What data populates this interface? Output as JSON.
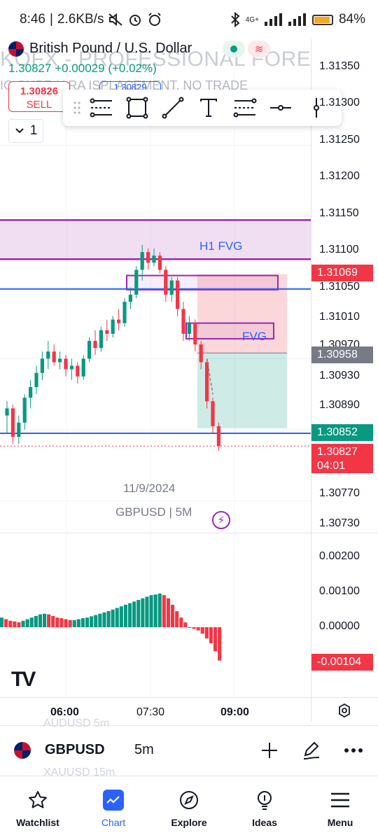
{
  "status_bar": {
    "time": "8:46",
    "network_speed": "2.6KB/s",
    "network_type": "4G+",
    "battery": "84",
    "battery_unit": "%",
    "icons": [
      "mute-icon",
      "alarm-icon",
      "alarm-clock-icon",
      "bluetooth-icon",
      "signal-icon",
      "battery-icon"
    ]
  },
  "header": {
    "title": "British Pound / U.S. Dollar",
    "watermark": "KOFX - PROFESSIONAL FOREX TRAD",
    "watermark_line2": "IG  CURR Y  RA  ISPLACEMENT. NO TRADE",
    "last_price": "1.30827",
    "change": "+0.00029",
    "change_pct": "(+0.02%)",
    "sell_price": "1.30826",
    "sell_label": "SELL",
    "buy_peek": "1.30829",
    "dropdown_value": "1"
  },
  "toolbar": {
    "tools": [
      "drag-handle-icon",
      "long-position-icon",
      "rectangle-icon",
      "trend-line-icon",
      "text-icon",
      "fib-retracement-icon",
      "horizontal-ray-icon",
      "vertical-line-icon"
    ]
  },
  "price_axis": {
    "labels": [
      "1.31350",
      "1.31300",
      "1.31250",
      "1.31200",
      "1.31150",
      "1.31100",
      "1.31050",
      "1.31010",
      "1.30970",
      "1.30930",
      "1.30890",
      "1.30770",
      "1.30730"
    ],
    "osc_labels": [
      "0.00200",
      "0.00100",
      "0.00000"
    ]
  },
  "price_tags": {
    "current_fvg_top": "1.31069",
    "stop_level": "1.30958",
    "target_level": "1.30852",
    "current_price": "1.30827",
    "countdown": "04:01",
    "oscillator_value": "-0.00104"
  },
  "zones": {
    "h1_fvg_label": "H1 FVG",
    "fvg_label": "FVG"
  },
  "chart_meta": {
    "date": "11/9/2024",
    "symbol_interval": "GBPUSD | 5M"
  },
  "time_axis": {
    "labels": [
      "06:00",
      "07:30",
      "09:00"
    ]
  },
  "symbol_bar": {
    "ghost_top": "AUDUSD  5m",
    "ghost_bottom": "XAUUSD  15m",
    "symbol": "GBPUSD",
    "interval": "5m"
  },
  "bottom_nav": [
    {
      "label": "Watchlist",
      "icon": "star-icon"
    },
    {
      "label": "Chart",
      "icon": "chart-icon"
    },
    {
      "label": "Explore",
      "icon": "compass-icon"
    },
    {
      "label": "Ideas",
      "icon": "lightbulb-icon"
    },
    {
      "label": "Menu",
      "icon": "hamburger-icon"
    }
  ],
  "colors": {
    "up": "#089981",
    "down": "#f23645",
    "accent": "#2962ff",
    "zone_purple": "#9c27b0"
  },
  "chart_data": {
    "type": "candlestick",
    "symbol": "GBPUSD",
    "interval": "5M",
    "ylim": [
      1.3071,
      1.3137
    ],
    "candles": [
      {
        "o": 1.3087,
        "h": 1.3089,
        "l": 1.30845,
        "c": 1.3088
      },
      {
        "o": 1.3088,
        "h": 1.30885,
        "l": 1.3083,
        "c": 1.3084
      },
      {
        "o": 1.3084,
        "h": 1.3087,
        "l": 1.3083,
        "c": 1.3086
      },
      {
        "o": 1.3086,
        "h": 1.309,
        "l": 1.3085,
        "c": 1.30895
      },
      {
        "o": 1.30895,
        "h": 1.3092,
        "l": 1.3088,
        "c": 1.3091
      },
      {
        "o": 1.3091,
        "h": 1.3094,
        "l": 1.309,
        "c": 1.3093
      },
      {
        "o": 1.3093,
        "h": 1.3096,
        "l": 1.3092,
        "c": 1.3095
      },
      {
        "o": 1.3095,
        "h": 1.30975,
        "l": 1.30935,
        "c": 1.3096
      },
      {
        "o": 1.3096,
        "h": 1.3097,
        "l": 1.3094,
        "c": 1.30945
      },
      {
        "o": 1.30945,
        "h": 1.3096,
        "l": 1.30935,
        "c": 1.3095
      },
      {
        "o": 1.3095,
        "h": 1.30955,
        "l": 1.30925,
        "c": 1.30935
      },
      {
        "o": 1.30935,
        "h": 1.3095,
        "l": 1.3092,
        "c": 1.3094
      },
      {
        "o": 1.3094,
        "h": 1.30945,
        "l": 1.30915,
        "c": 1.30925
      },
      {
        "o": 1.30925,
        "h": 1.30955,
        "l": 1.3092,
        "c": 1.3095
      },
      {
        "o": 1.3095,
        "h": 1.3098,
        "l": 1.30945,
        "c": 1.30975
      },
      {
        "o": 1.30975,
        "h": 1.3099,
        "l": 1.30955,
        "c": 1.30965
      },
      {
        "o": 1.30965,
        "h": 1.30995,
        "l": 1.3096,
        "c": 1.3099
      },
      {
        "o": 1.3099,
        "h": 1.31005,
        "l": 1.30975,
        "c": 1.30985
      },
      {
        "o": 1.30985,
        "h": 1.3101,
        "l": 1.3098,
        "c": 1.31005
      },
      {
        "o": 1.31005,
        "h": 1.3102,
        "l": 1.3099,
        "c": 1.31
      },
      {
        "o": 1.31,
        "h": 1.31035,
        "l": 1.30995,
        "c": 1.3103
      },
      {
        "o": 1.3103,
        "h": 1.3105,
        "l": 1.3102,
        "c": 1.3104
      },
      {
        "o": 1.3104,
        "h": 1.3108,
        "l": 1.31035,
        "c": 1.31075
      },
      {
        "o": 1.31075,
        "h": 1.3111,
        "l": 1.3106,
        "c": 1.311
      },
      {
        "o": 1.311,
        "h": 1.31105,
        "l": 1.31075,
        "c": 1.31085
      },
      {
        "o": 1.31085,
        "h": 1.31105,
        "l": 1.3108,
        "c": 1.31095
      },
      {
        "o": 1.31095,
        "h": 1.311,
        "l": 1.3107,
        "c": 1.31075
      },
      {
        "o": 1.31075,
        "h": 1.3108,
        "l": 1.3103,
        "c": 1.3104
      },
      {
        "o": 1.3104,
        "h": 1.31065,
        "l": 1.3103,
        "c": 1.3106
      },
      {
        "o": 1.3106,
        "h": 1.31065,
        "l": 1.3101,
        "c": 1.3102
      },
      {
        "o": 1.3102,
        "h": 1.3103,
        "l": 1.30975,
        "c": 1.30985
      },
      {
        "o": 1.30985,
        "h": 1.3101,
        "l": 1.30975,
        "c": 1.31
      },
      {
        "o": 1.31,
        "h": 1.31005,
        "l": 1.3096,
        "c": 1.3097
      },
      {
        "o": 1.3097,
        "h": 1.30975,
        "l": 1.30935,
        "c": 1.30945
      },
      {
        "o": 1.30945,
        "h": 1.3095,
        "l": 1.3088,
        "c": 1.3089
      },
      {
        "o": 1.3089,
        "h": 1.30895,
        "l": 1.30845,
        "c": 1.30855
      },
      {
        "o": 1.30855,
        "h": 1.3086,
        "l": 1.3082,
        "c": 1.30827
      }
    ],
    "oscillator": {
      "type": "histogram",
      "ylim": [
        -0.0012,
        0.0024
      ],
      "values": [
        0.0003,
        0.00025,
        0.0002,
        0.00018,
        0.00015,
        0.0002,
        0.00025,
        0.0003,
        0.00035,
        0.0004,
        0.00042,
        0.0004,
        0.00035,
        0.0003,
        0.00028,
        0.00025,
        0.00022,
        0.00022,
        0.00025,
        0.00028,
        0.0003,
        0.00034,
        0.00038,
        0.00042,
        0.00046,
        0.0005,
        0.00055,
        0.0006,
        0.00065,
        0.0007,
        0.00075,
        0.0008,
        0.00085,
        0.0009,
        0.00095,
        0.001,
        0.00102,
        0.00105,
        0.001,
        0.0009,
        0.0007,
        0.0005,
        0.0003,
        0.00015,
        0.0,
        -5e-05,
        -0.0001,
        -0.0002,
        -0.00035,
        -0.0005,
        -0.00075,
        -0.00104
      ]
    }
  }
}
